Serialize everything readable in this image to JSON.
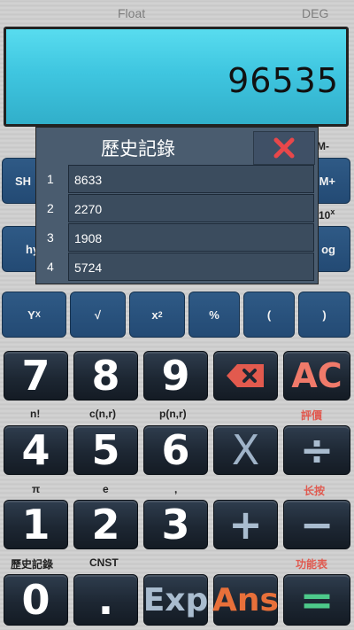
{
  "status": {
    "mode": "Float",
    "angle": "DEG"
  },
  "display": {
    "value": "96535"
  },
  "history": {
    "title": "歷史記錄",
    "close_icon": "close-x-icon",
    "items": [
      {
        "index": "1",
        "value": "8633"
      },
      {
        "index": "2",
        "value": "2270"
      },
      {
        "index": "3",
        "value": "1908"
      },
      {
        "index": "4",
        "value": "5724"
      }
    ]
  },
  "partial_labels": {
    "sh": "SH",
    "hy": "hy",
    "m_minus": "M-",
    "m_plus": "M+",
    "ten_x_base": "10",
    "ten_x_sup": "x",
    "log": "og"
  },
  "sci_row": {
    "yx_base": "Y",
    "yx_sup": "X",
    "sqrt": "√",
    "x2_base": "x",
    "x2_sup": "2",
    "percent": "%",
    "lparen": "(",
    "rparen": ")"
  },
  "digits": {
    "d7": "7",
    "d8": "8",
    "d9": "9",
    "d4": "4",
    "d5": "5",
    "d6": "6",
    "d1": "1",
    "d2": "2",
    "d3": "3",
    "d0": "0",
    "dot": "."
  },
  "ops": {
    "ac": "AC",
    "mul": "X",
    "div": "÷",
    "plus": "+",
    "minus": "−",
    "exp": "Exp",
    "ans": "Ans",
    "equals": "="
  },
  "secondary": {
    "fact": "n!",
    "ncr": "c(n,r)",
    "npr": "p(n,r)",
    "rate": "評價",
    "pi": "π",
    "e": "e",
    "comma": ",",
    "long_press": "长按",
    "history": "歷史記錄",
    "cnst": "CNST",
    "function_table": "功能表"
  },
  "colors": {
    "display_bg": "#3fc6e0",
    "accent_red": "#e05a50",
    "ac_text": "#f07a6a",
    "ans_text": "#e8703a",
    "equals_bar": "#4dc98a"
  }
}
